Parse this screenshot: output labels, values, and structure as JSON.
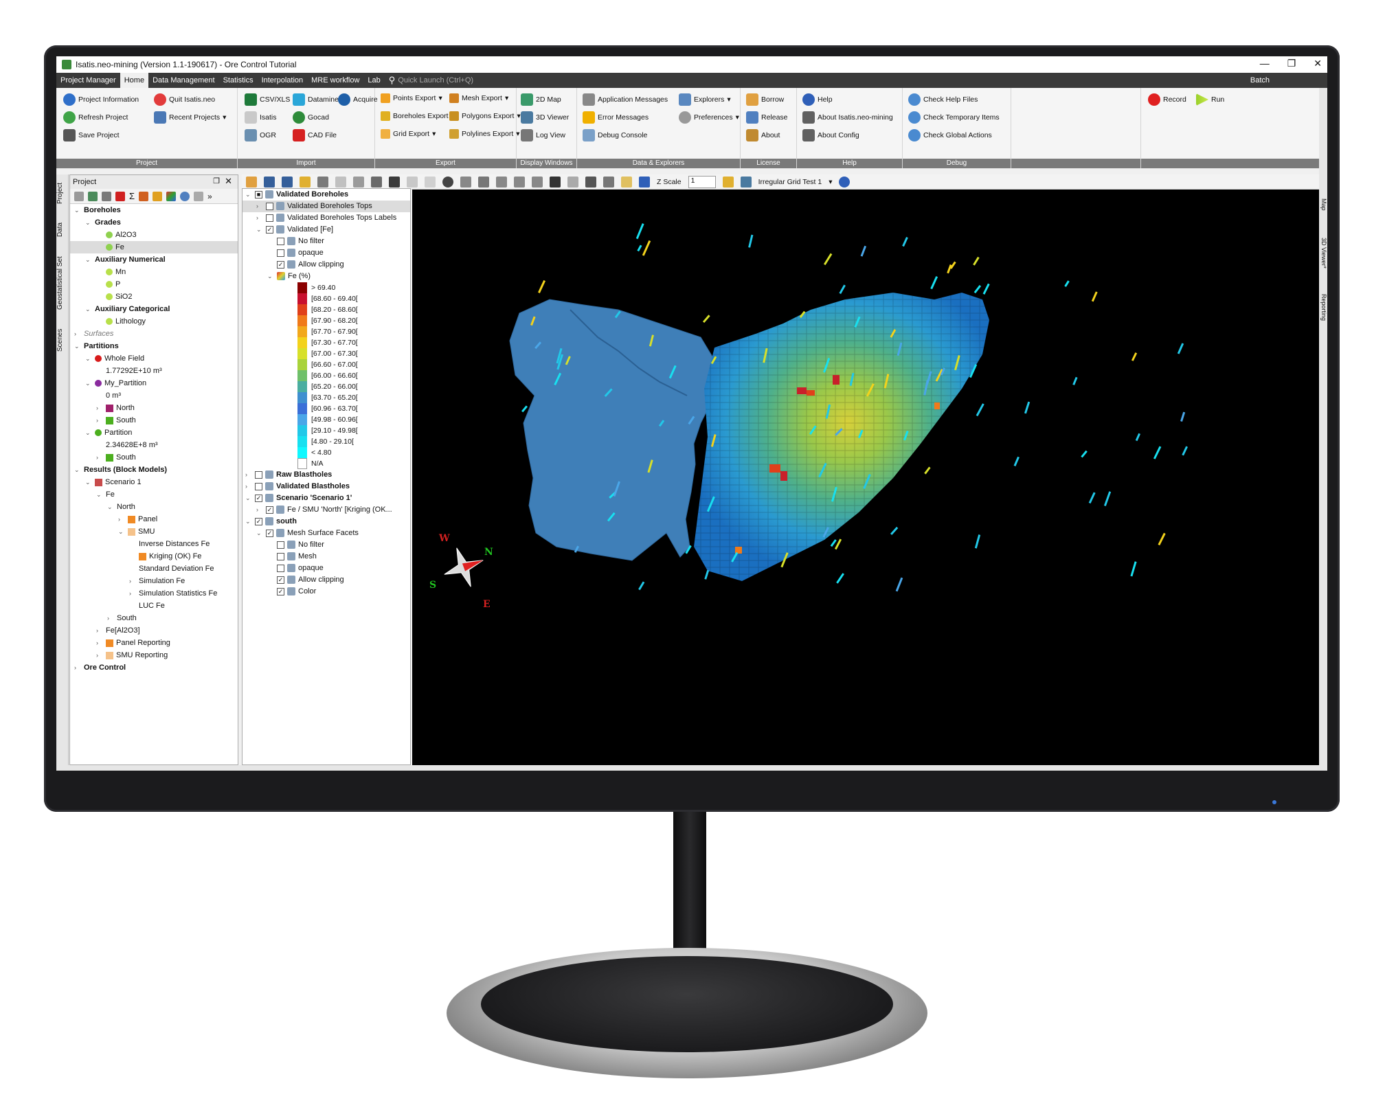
{
  "window": {
    "title": "Isatis.neo-mining (Version 1.1-190617) - Ore Control Tutorial",
    "minimize": "—",
    "maximize": "❐",
    "close": "✕"
  },
  "menu": {
    "items": [
      "Project Manager",
      "Home",
      "Data Management",
      "Statistics",
      "Interpolation",
      "MRE workflow",
      "Lab"
    ],
    "active": "Home",
    "quick_launch_placeholder": "Quick Launch (Ctrl+Q)",
    "batch": "Batch"
  },
  "ribbon": {
    "project": {
      "label": "Project",
      "project_information": "Project Information",
      "quit": "Quit Isatis.neo",
      "refresh": "Refresh Project",
      "recent": "Recent Projects",
      "save": "Save Project"
    },
    "import": {
      "label": "Import",
      "csv": "CSV/XLS",
      "datamine": "Datamine",
      "acquire": "Acquire",
      "isatis": "Isatis",
      "gocad": "Gocad",
      "ogr": "OGR",
      "cad": "CAD File"
    },
    "export": {
      "label": "Export",
      "points": "Points Export",
      "mesh": "Mesh Export",
      "boreholes": "Boreholes Export",
      "polygons": "Polygons Export",
      "grid": "Grid Export",
      "polylines": "Polylines Export"
    },
    "display": {
      "label": "Display Windows",
      "map2d": "2D Map",
      "viewer3d": "3D Viewer",
      "log": "Log View"
    },
    "data_explorers": {
      "label": "Data & Explorers",
      "app_messages": "Application Messages",
      "explorers": "Explorers",
      "error_messages": "Error Messages",
      "preferences": "Preferences",
      "debug_console": "Debug Console"
    },
    "license": {
      "label": "License",
      "borrow": "Borrow",
      "release": "Release",
      "about": "About"
    },
    "help": {
      "label": "Help",
      "help": "Help",
      "about_isatis": "About Isatis.neo-mining",
      "about_config": "About Config"
    },
    "debug": {
      "label": "Debug",
      "check_help": "Check Help Files",
      "check_temp": "Check Temporary Items",
      "check_global": "Check Global Actions"
    },
    "record": "Record",
    "run": "Run"
  },
  "left_tabs": [
    "Project",
    "Data",
    "Geostatistical Set",
    "Scenes"
  ],
  "right_tabs": [
    "Map",
    "3D Viewer*",
    "Reporting"
  ],
  "project_panel": {
    "title": "Project",
    "tree": [
      {
        "label": "Boreholes",
        "level": 0,
        "arrow": "v",
        "bold": true
      },
      {
        "label": "Grades",
        "level": 1,
        "arrow": "v",
        "bold": true
      },
      {
        "label": "Al2O3",
        "level": 2,
        "icon": "dot",
        "color": "#8fd14f"
      },
      {
        "label": "Fe",
        "level": 2,
        "icon": "dot",
        "color": "#8fd14f",
        "selected": true
      },
      {
        "label": "Auxiliary Numerical",
        "level": 1,
        "arrow": "v",
        "bold": true
      },
      {
        "label": "Mn",
        "level": 2,
        "icon": "dot",
        "color": "#b8e04a"
      },
      {
        "label": "P",
        "level": 2,
        "icon": "dot",
        "color": "#b8e04a"
      },
      {
        "label": "SiO2",
        "level": 2,
        "icon": "dot",
        "color": "#b8e04a"
      },
      {
        "label": "Auxiliary Categorical",
        "level": 1,
        "arrow": "v",
        "bold": true
      },
      {
        "label": "Lithology",
        "level": 2,
        "icon": "dot",
        "color": "#b8e04a"
      },
      {
        "label": "Surfaces",
        "level": 0,
        "arrow": ">",
        "italic": true
      },
      {
        "label": "Partitions",
        "level": 0,
        "arrow": "v",
        "bold": true
      },
      {
        "label": "Whole Field",
        "level": 1,
        "arrow": "v",
        "icon": "dot",
        "color": "#d81b1b"
      },
      {
        "label": "1.77292E+10 m³",
        "level": 2
      },
      {
        "label": "My_Partition",
        "level": 1,
        "arrow": "v",
        "icon": "dot",
        "color": "#8a2b9e"
      },
      {
        "label": "0 m³",
        "level": 2
      },
      {
        "label": "North",
        "level": 2,
        "arrow": ">",
        "icon": "sq",
        "color": "#a0206b"
      },
      {
        "label": "South",
        "level": 2,
        "arrow": ">",
        "icon": "sq",
        "color": "#4caf1f"
      },
      {
        "label": "Partition",
        "level": 1,
        "arrow": "v",
        "icon": "dot",
        "color": "#4caf1f"
      },
      {
        "label": "2.34628E+8 m³",
        "level": 2
      },
      {
        "label": "South",
        "level": 2,
        "arrow": ">",
        "icon": "sq",
        "color": "#4caf1f"
      },
      {
        "label": "Results (Block Models)",
        "level": 0,
        "arrow": "v",
        "bold": true
      },
      {
        "label": "Scenario 1",
        "level": 1,
        "arrow": "v",
        "icon": "sq",
        "color": "#c84b4b"
      },
      {
        "label": "Fe",
        "level": 2,
        "arrow": "v"
      },
      {
        "label": "North",
        "level": 3,
        "arrow": "v"
      },
      {
        "label": "Panel",
        "level": 4,
        "arrow": ">",
        "icon": "sq",
        "color": "#f08a24"
      },
      {
        "label": "SMU",
        "level": 4,
        "arrow": "v",
        "icon": "sq",
        "color": "#f5c28a"
      },
      {
        "label": "Inverse Distances Fe",
        "level": 5
      },
      {
        "label": "Kriging (OK) Fe",
        "level": 5,
        "icon": "sq",
        "color": "#f08a24"
      },
      {
        "label": "Standard Deviation Fe",
        "level": 5
      },
      {
        "label": "Simulation Fe",
        "level": 5,
        "arrow": ">"
      },
      {
        "label": "Simulation Statistics Fe",
        "level": 5,
        "arrow": ">"
      },
      {
        "label": "LUC Fe",
        "level": 5
      },
      {
        "label": "South",
        "level": 3,
        "arrow": ">"
      },
      {
        "label": "Fe[Al2O3]",
        "level": 2,
        "arrow": ">"
      },
      {
        "label": "Panel Reporting",
        "level": 2,
        "arrow": ">",
        "icon": "sq",
        "color": "#f08a24"
      },
      {
        "label": "SMU Reporting",
        "level": 2,
        "arrow": ">",
        "icon": "sq",
        "color": "#f5c28a"
      },
      {
        "label": "Ore Control",
        "level": 0,
        "arrow": ">",
        "bold": true
      }
    ]
  },
  "layers_panel": {
    "items": [
      {
        "label": "Validated Boreholes",
        "level": 0,
        "arrow": "v",
        "check": "partial",
        "bold": true
      },
      {
        "label": "Validated Boreholes Tops",
        "level": 1,
        "arrow": ">",
        "check": "off",
        "selected": true
      },
      {
        "label": "Validated Boreholes Tops Labels",
        "level": 1,
        "arrow": ">",
        "check": "off"
      },
      {
        "label": "Validated [Fe]",
        "level": 1,
        "arrow": "v",
        "check": "on"
      },
      {
        "label": "No filter",
        "level": 2,
        "check": "off"
      },
      {
        "label": "opaque",
        "level": 2,
        "check": "off"
      },
      {
        "label": "Allow clipping",
        "level": 2,
        "check": "on"
      },
      {
        "label": "Fe (%)",
        "level": 2,
        "arrow": "v"
      }
    ],
    "legend": [
      {
        "label": "> 69.40",
        "color": "#8b0000"
      },
      {
        "label": "[68.60 - 69.40[",
        "color": "#c8102e"
      },
      {
        "label": "[68.20 - 68.60[",
        "color": "#e0401a"
      },
      {
        "label": "[67.90 - 68.20[",
        "color": "#f07a1a"
      },
      {
        "label": "[67.70 - 67.90[",
        "color": "#f2a81c"
      },
      {
        "label": "[67.30 - 67.70[",
        "color": "#f3d21c"
      },
      {
        "label": "[67.00 - 67.30[",
        "color": "#d7e02a"
      },
      {
        "label": "[66.60 - 67.00[",
        "color": "#a9d33a"
      },
      {
        "label": "[66.00 - 66.60[",
        "color": "#6fc06a"
      },
      {
        "label": "[65.20 - 66.00[",
        "color": "#4aaea0"
      },
      {
        "label": "[63.70 - 65.20[",
        "color": "#3f8fd0"
      },
      {
        "label": "[60.96 - 63.70[",
        "color": "#3a6fd8"
      },
      {
        "label": "[49.98 - 60.96[",
        "color": "#4aa6e8"
      },
      {
        "label": "[29.10 - 49.98[",
        "color": "#22c8e8"
      },
      {
        "label": "[4.80 - 29.10[",
        "color": "#18e0f0"
      },
      {
        "label": "< 4.80",
        "color": "#10f8ff"
      },
      {
        "label": "N/A",
        "color": "#ffffff"
      }
    ],
    "items2": [
      {
        "label": "Raw Blastholes",
        "level": 0,
        "arrow": ">",
        "check": "off",
        "bold": true
      },
      {
        "label": "Validated Blastholes",
        "level": 0,
        "arrow": ">",
        "check": "off",
        "bold": true
      },
      {
        "label": "Scenario 'Scenario 1'",
        "level": 0,
        "arrow": "v",
        "check": "on",
        "bold": true
      },
      {
        "label": "Fe / SMU 'North' [Kriging (OK...",
        "level": 1,
        "arrow": ">",
        "check": "on"
      },
      {
        "label": "south",
        "level": 0,
        "arrow": "v",
        "check": "on",
        "bold": true
      },
      {
        "label": "Mesh Surface Facets",
        "level": 1,
        "arrow": "v",
        "check": "on"
      },
      {
        "label": "No filter",
        "level": 2,
        "check": "off"
      },
      {
        "label": "Mesh",
        "level": 2,
        "check": "off"
      },
      {
        "label": "opaque",
        "level": 2,
        "check": "off"
      },
      {
        "label": "Allow clipping",
        "level": 2,
        "check": "on"
      },
      {
        "label": "Color",
        "level": 2,
        "check": "on"
      }
    ]
  },
  "toolbar3d": {
    "z_scale_label": "Z Scale",
    "z_scale_value": "1",
    "grid_name": "Irregular Grid Test 1"
  },
  "compass": {
    "w": "W",
    "n": "N",
    "s": "S",
    "e": "E"
  },
  "colors": {
    "menubar": "#3a3a3a",
    "ribbon_label": "#7a7a7a",
    "viewer_bg": "#000000",
    "mesh_blue": "#3f7fb8"
  }
}
